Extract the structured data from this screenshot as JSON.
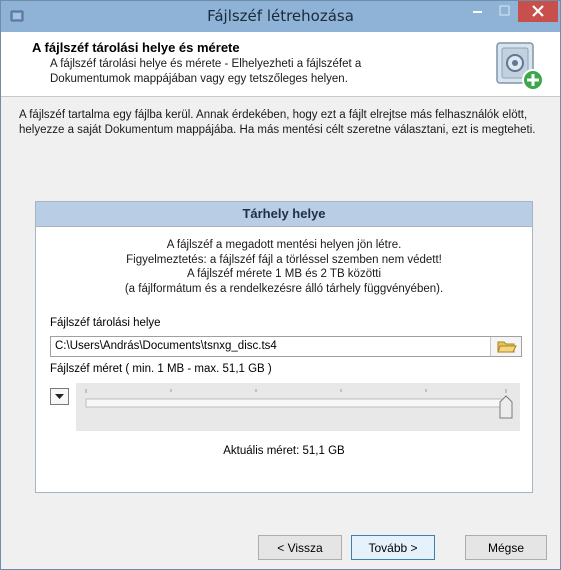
{
  "window": {
    "title": "Fájlszéf létrehozása"
  },
  "header": {
    "title": "A fájlszéf tárolási helye és mérete",
    "subtitle": "A fájlszéf tárolási helye és mérete - Elhelyezheti a fájlszéfet a Dokumentumok mappájában vagy egy tetszőleges helyen."
  },
  "intro": "A fájlszéf tartalma egy fájlba kerül. Annak érdekében, hogy ezt a fájlt elrejtse más felhasználók elött, helyezze a saját Dokumentum mappájába. Ha más mentési célt szeretne választani, ezt is megteheti.",
  "group": {
    "title": "Tárhely helye",
    "info_line1": "A fájlszéf a megadott mentési helyen jön létre.",
    "info_line2": "Figyelmeztetés: a fájlszéf fájl a törléssel szemben nem védett!",
    "info_line3": "A fájlszéf mérete 1 MB és 2 TB közötti",
    "info_line4": "(a fájlformátum és a rendelkezésre álló tárhely függvényében).",
    "location_label": "Fájlszéf tárolási helye",
    "location_value": "C:\\Users\\András\\Documents\\tsnxg_disc.ts4",
    "size_label": "Fájlszéf méret ( min. 1 MB - max. 51,1 GB )",
    "slider_position": 1.0,
    "current_size": "Aktuális méret: 51,1 GB"
  },
  "buttons": {
    "back": "< Vissza",
    "next": "Tovább >",
    "cancel": "Mégse"
  },
  "colors": {
    "titlebar": "#8fb3d7",
    "close": "#c7504c",
    "group_header": "#b9cde5"
  }
}
